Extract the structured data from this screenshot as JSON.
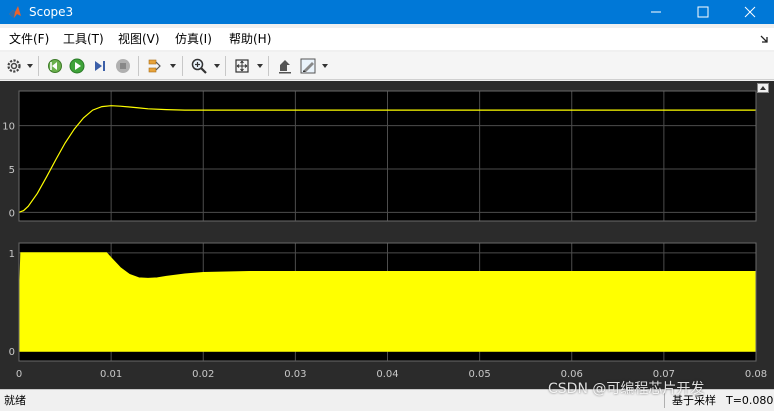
{
  "window": {
    "title": "Scope3",
    "icon": "matlab-icon"
  },
  "menu": {
    "items": [
      {
        "label": "文件(F)",
        "id": "file"
      },
      {
        "label": "工具(T)",
        "id": "tools"
      },
      {
        "label": "视图(V)",
        "id": "view"
      },
      {
        "label": "仿真(I)",
        "id": "simulation"
      },
      {
        "label": "帮助(H)",
        "id": "help"
      }
    ]
  },
  "toolbar": {
    "icons": [
      "gear-icon",
      "step-back-icon",
      "run-icon",
      "step-forward-icon",
      "stop-icon",
      "signal-selector-icon",
      "zoom-icon",
      "fit-axes-icon",
      "highlight-icon",
      "style-icon"
    ]
  },
  "colors": {
    "trace": "#ffff00",
    "axes_background": "#000000",
    "figure_background": "#2b2b2b",
    "grid": "#4d4d4d",
    "tick_text": "#c8c8c8",
    "titlebar": "#0078d7"
  },
  "status": {
    "left": "就绪",
    "mode": "基于采样",
    "time": "T=0.080"
  },
  "watermark": "CSDN @可编程芯片开发",
  "chart_data": [
    {
      "type": "line",
      "name": "upper-axes",
      "xlim": [
        0,
        0.08
      ],
      "ylim": [
        -1,
        14
      ],
      "yticks": [
        0,
        5,
        10
      ],
      "ytick_labels": [
        "0",
        "5",
        "10"
      ],
      "xticks": [
        0,
        0.01,
        0.02,
        0.03,
        0.04,
        0.05,
        0.06,
        0.07,
        0.08
      ],
      "grid": true,
      "series": [
        {
          "x": [
            0,
            0.0005,
            0.001,
            0.002,
            0.003,
            0.004,
            0.005,
            0.006,
            0.007,
            0.008,
            0.009,
            0.01,
            0.011,
            0.012,
            0.013,
            0.014,
            0.016,
            0.018,
            0.02,
            0.025,
            0.03,
            0.04,
            0.05,
            0.06,
            0.07,
            0.08
          ],
          "values": [
            0,
            0.2,
            0.7,
            2.2,
            4.1,
            6.1,
            8.0,
            9.6,
            10.9,
            11.8,
            12.2,
            12.3,
            12.25,
            12.15,
            12.05,
            11.95,
            11.85,
            11.8,
            11.8,
            11.8,
            11.8,
            11.8,
            11.8,
            11.8,
            11.8,
            11.8
          ]
        }
      ]
    },
    {
      "type": "area",
      "name": "lower-axes",
      "xlim": [
        0,
        0.08
      ],
      "ylim": [
        -0.1,
        1.1
      ],
      "yticks": [
        0,
        0.5,
        1
      ],
      "ytick_labels": [
        "0",
        "",
        "1"
      ],
      "xticks": [
        0,
        0.01,
        0.02,
        0.03,
        0.04,
        0.05,
        0.06,
        0.07,
        0.08
      ],
      "xtick_labels": [
        "0",
        "0.01",
        "0.02",
        "0.03",
        "0.04",
        "0.05",
        "0.06",
        "0.07",
        "0.08"
      ],
      "grid": true,
      "series": [
        {
          "x": [
            0,
            0.0002,
            0.001,
            0.0095,
            0.01,
            0.011,
            0.012,
            0.013,
            0.014,
            0.015,
            0.016,
            0.018,
            0.02,
            0.025,
            0.03,
            0.04,
            0.05,
            0.06,
            0.07,
            0.08
          ],
          "values": [
            0.38,
            1.0,
            1.0,
            1.0,
            0.95,
            0.85,
            0.78,
            0.745,
            0.74,
            0.745,
            0.76,
            0.785,
            0.8,
            0.81,
            0.81,
            0.81,
            0.81,
            0.81,
            0.81,
            0.81
          ],
          "lower": 0
        }
      ]
    }
  ]
}
